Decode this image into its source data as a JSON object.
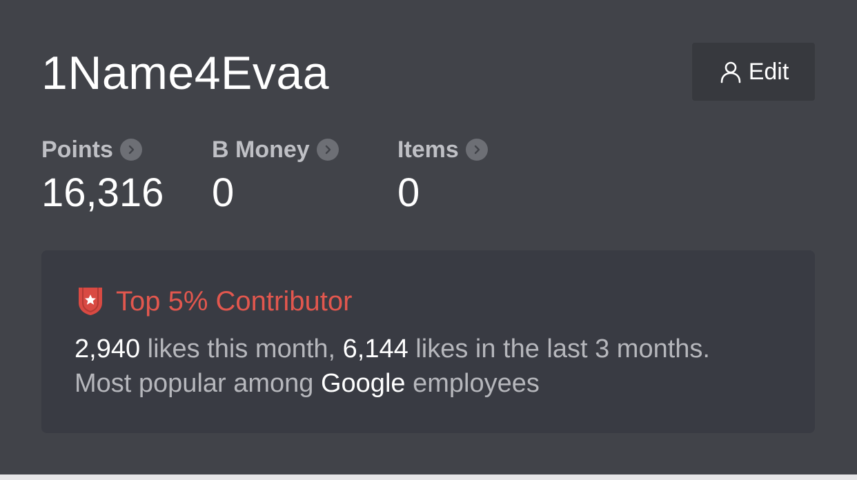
{
  "profile": {
    "username": "1Name4Evaa",
    "edit_label": "Edit",
    "edit_icon": "user-icon"
  },
  "stats": [
    {
      "label": "Points",
      "value": "16,316",
      "icon": "chevron-right-icon"
    },
    {
      "label": "B Money",
      "value": "0",
      "icon": "chevron-right-icon"
    },
    {
      "label": "Items",
      "value": "0",
      "icon": "chevron-right-icon"
    }
  ],
  "contributor": {
    "icon": "shield-star-icon",
    "title": "Top 5% Contributor",
    "likes_month": "2,940",
    "text_1": " likes this month, ",
    "likes_3months": "6,144",
    "text_2": " likes in the last 3 months. Most popular among ",
    "company": "Google",
    "text_3": " employees"
  },
  "colors": {
    "background": "#414349",
    "card": "#393b43",
    "accent_red": "#e2574e",
    "label_gray": "#bfc0c5",
    "text_gray": "#b6b7bc"
  }
}
